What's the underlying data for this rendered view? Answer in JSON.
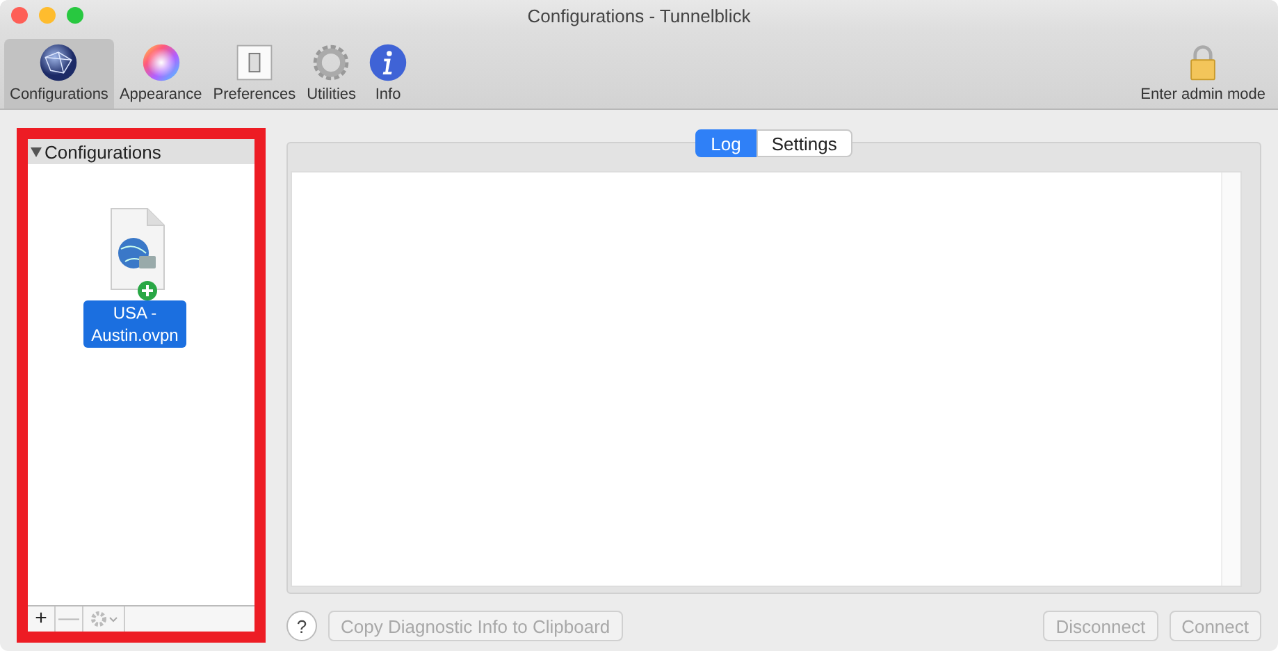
{
  "window": {
    "title": "Configurations - Tunnelblick"
  },
  "toolbar": {
    "items": [
      {
        "label": "Configurations",
        "kind": "globe",
        "selected": true
      },
      {
        "label": "Appearance",
        "kind": "colorwheel",
        "selected": false
      },
      {
        "label": "Preferences",
        "kind": "switch",
        "selected": false
      },
      {
        "label": "Utilities",
        "kind": "gear",
        "selected": false
      },
      {
        "label": "Info",
        "kind": "info",
        "selected": false
      }
    ],
    "admin": {
      "label": "Enter admin mode"
    }
  },
  "sidebar": {
    "header": "Configurations",
    "expanded": true,
    "items": [
      {
        "label": "USA - Austin.ovpn",
        "selected": true
      }
    ],
    "buttons": [
      {
        "label": "+",
        "disabled": false
      },
      {
        "label": "—",
        "disabled": true
      }
    ]
  },
  "tabs": [
    {
      "label": "Log",
      "selected": true
    },
    {
      "label": "Settings",
      "selected": false
    }
  ],
  "help": "?",
  "buttons": [
    {
      "label": "Copy Diagnostic Info to Clipboard",
      "disabled": true
    }
  ],
  "actions": [
    {
      "label": "Disconnect",
      "disabled": true
    },
    {
      "label": "Connect",
      "disabled": true
    }
  ]
}
